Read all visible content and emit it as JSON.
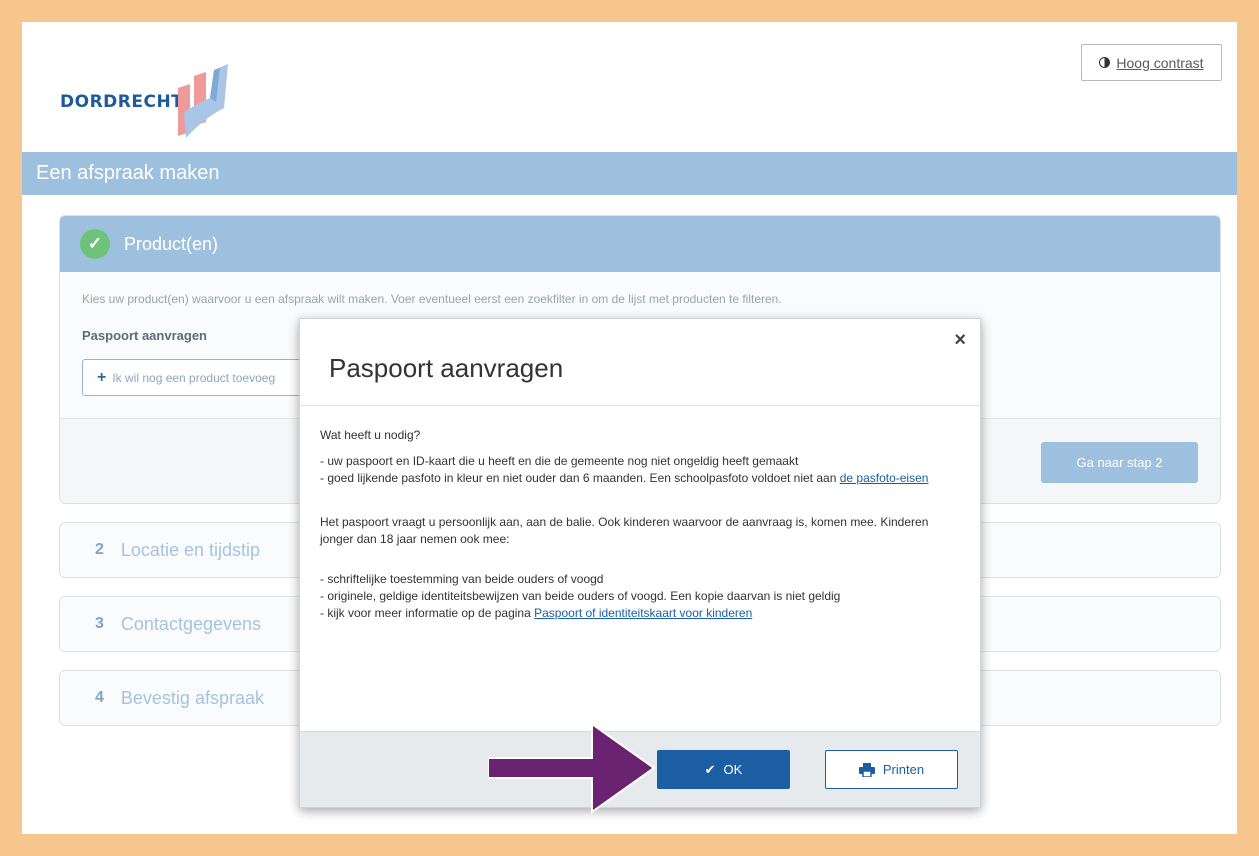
{
  "header": {
    "logo_text": "DORDRECHT",
    "contrast_label": "Hoog contrast",
    "contrast_icon": "half-circle-icon"
  },
  "page_title": "Een afspraak maken",
  "step1": {
    "title": "Product(en)",
    "icon": "check-icon",
    "hint": "Kies uw product(en) waarvoor u een afspraak wilt maken. Voer eventueel eerst een zoekfilter in om de lijst met producten te filteren.",
    "product_label": "Paspoort aanvragen",
    "add_label": "Ik wil nog een product toevoeg",
    "next_label": "Ga naar stap 2"
  },
  "steps": [
    {
      "num": "2",
      "label": "Locatie en tijdstip"
    },
    {
      "num": "3",
      "label": "Contactgegevens"
    },
    {
      "num": "4",
      "label": "Bevestig afspraak"
    }
  ],
  "modal": {
    "title": "Paspoort aanvragen",
    "close": "×",
    "q": "Wat heeft u nodig?",
    "req1": "- uw paspoort en ID-kaart die u heeft en die de gemeente nog niet ongeldig heeft gemaakt",
    "req2": "- goed lijkende pasfoto in kleur en niet ouder dan 6 maanden. Een schoolpasfoto voldoet niet aan",
    "req2_link": "de pasfoto-eisen",
    "para": "Het paspoort vraagt u persoonlijk aan, aan de balie. Ook kinderen waarvoor de aanvraag is, komen mee. Kinderen jonger dan 18 jaar nemen ook mee:",
    "kid1": "- schriftelijke toestemming van beide ouders of voogd",
    "kid2": "- originele, geldige identiteitsbewijzen van beide ouders of voogd. Een kopie daarvan is niet geldig",
    "kid3": "- kijk voor meer informatie op de pagina",
    "kid3_link": "Paspoort of identiteitskaart voor kinderen",
    "ok_label": "OK",
    "print_label": "Printen"
  },
  "colors": {
    "frame": "#f7c68f",
    "accent": "#9dc0de",
    "primary": "#1b5ea4",
    "arrow": "#6a2370",
    "success": "#6ec27a"
  }
}
